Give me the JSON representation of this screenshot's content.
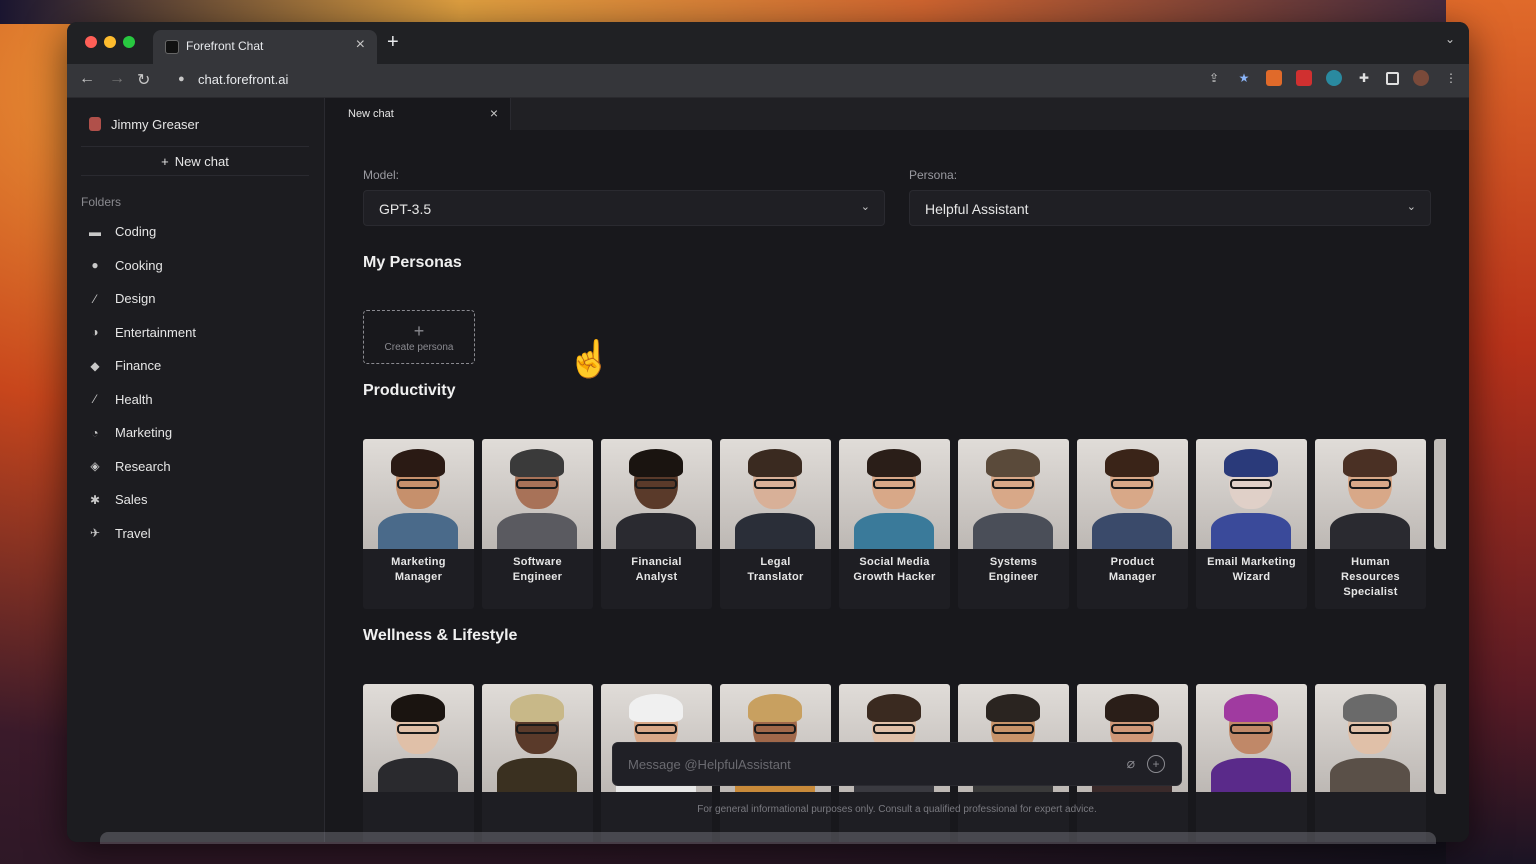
{
  "browser": {
    "tab_title": "Forefront Chat",
    "tab_close": "×",
    "new_tab": "+",
    "tab_list": "⌄",
    "url": "chat.forefront.ai",
    "nav_back": "←",
    "nav_forward": "→",
    "nav_reload": "↻",
    "lock": "🔒"
  },
  "sidebar": {
    "user_name": "Jimmy Greaser",
    "new_chat_plus": "+",
    "new_chat_label": "New chat",
    "folders_label": "Folders",
    "folders": [
      {
        "label": "Coding",
        "icon": "laptop-icon",
        "glyph": "▬"
      },
      {
        "label": "Cooking",
        "icon": "cooking-icon",
        "glyph": "●"
      },
      {
        "label": "Design",
        "icon": "pencil-icon",
        "glyph": "⁄"
      },
      {
        "label": "Entertainment",
        "icon": "entertainment-icon",
        "glyph": "◑"
      },
      {
        "label": "Finance",
        "icon": "money-bag-icon",
        "glyph": "◆"
      },
      {
        "label": "Health",
        "icon": "health-icon",
        "glyph": "⁄"
      },
      {
        "label": "Marketing",
        "icon": "marketing-icon",
        "glyph": "◔"
      },
      {
        "label": "Research",
        "icon": "research-icon",
        "glyph": "◈"
      },
      {
        "label": "Sales",
        "icon": "sales-icon",
        "glyph": "✱"
      },
      {
        "label": "Travel",
        "icon": "travel-icon",
        "glyph": "✈"
      }
    ]
  },
  "chat_tab": {
    "label": "New chat",
    "close": "×"
  },
  "main": {
    "model_label": "Model:",
    "model_value": "GPT-3.5",
    "persona_label": "Persona:",
    "persona_value": "Helpful Assistant",
    "chevron": "⌄",
    "my_personas_title": "My Personas",
    "create_persona_plus": "+",
    "create_persona_label": "Create persona",
    "productivity_title": "Productivity",
    "productivity": [
      {
        "line1": "Marketing",
        "line2": "Manager",
        "line3": "",
        "skin": "#c6906c",
        "hair": "#2a1a14",
        "body": "#4a6a8a"
      },
      {
        "line1": "Software",
        "line2": "Engineer",
        "line3": "",
        "skin": "#a87258",
        "hair": "#3a3a3a",
        "body": "#5a5a60"
      },
      {
        "line1": "Financial",
        "line2": "Analyst",
        "line3": "",
        "skin": "#5a3a2a",
        "hair": "#1a1410",
        "body": "#2a2a30"
      },
      {
        "line1": "Legal",
        "line2": "Translator",
        "line3": "",
        "skin": "#d8b098",
        "hair": "#3a2a20",
        "body": "#2a2e38"
      },
      {
        "line1": "Social Media",
        "line2": "Growth Hacker",
        "line3": "",
        "skin": "#d8a888",
        "hair": "#2a1e18",
        "body": "#3a7a9a"
      },
      {
        "line1": "Systems",
        "line2": "Engineer",
        "line3": "",
        "skin": "#d8a888",
        "hair": "#5a4a3a",
        "body": "#4a4e58"
      },
      {
        "line1": "Product",
        "line2": "Manager",
        "line3": "",
        "skin": "#d8a888",
        "hair": "#3a2418",
        "body": "#3a4a6a"
      },
      {
        "line1": "Email Marketing",
        "line2": "Wizard",
        "line3": "",
        "skin": "#e0d0c8",
        "hair": "#2a3a7a",
        "body": "#3a4a9a"
      },
      {
        "line1": "Human",
        "line2": "Resources",
        "line3": "Specialist",
        "skin": "#d8a888",
        "hair": "#4a3024",
        "body": "#2a2a30"
      }
    ],
    "wellness_title": "Wellness & Lifestyle",
    "wellness": [
      {
        "skin": "#e0c0a8",
        "hair": "#1a1410",
        "body": "#2a2a2e"
      },
      {
        "skin": "#5a3a2a",
        "hair": "#c8b888",
        "body": "#3a3020"
      },
      {
        "skin": "#d8a888",
        "hair": "#f0f0f0",
        "body": "#e8e8e8"
      },
      {
        "skin": "#a0684a",
        "hair": "#c8a060",
        "body": "#c88a3a"
      },
      {
        "skin": "#e0c0a8",
        "hair": "#3a2a20",
        "body": "#3a3a40"
      },
      {
        "skin": "#c8946a",
        "hair": "#2a2420",
        "body": "#3a3a3a"
      },
      {
        "skin": "#d09878",
        "hair": "#2a1e18",
        "body": "#3a2a2a"
      },
      {
        "skin": "#c08868",
        "hair": "#a03aa0",
        "body": "#5a2a8a"
      },
      {
        "skin": "#e0c0a8",
        "hair": "#6a6a6a",
        "body": "#5a5048"
      }
    ],
    "message_placeholder": "Message @HelpfulAssistant",
    "attach_glyph": "⌀",
    "add_glyph": "+",
    "disclaimer": "For general informational purposes only. Consult a qualified professional for expert advice."
  }
}
